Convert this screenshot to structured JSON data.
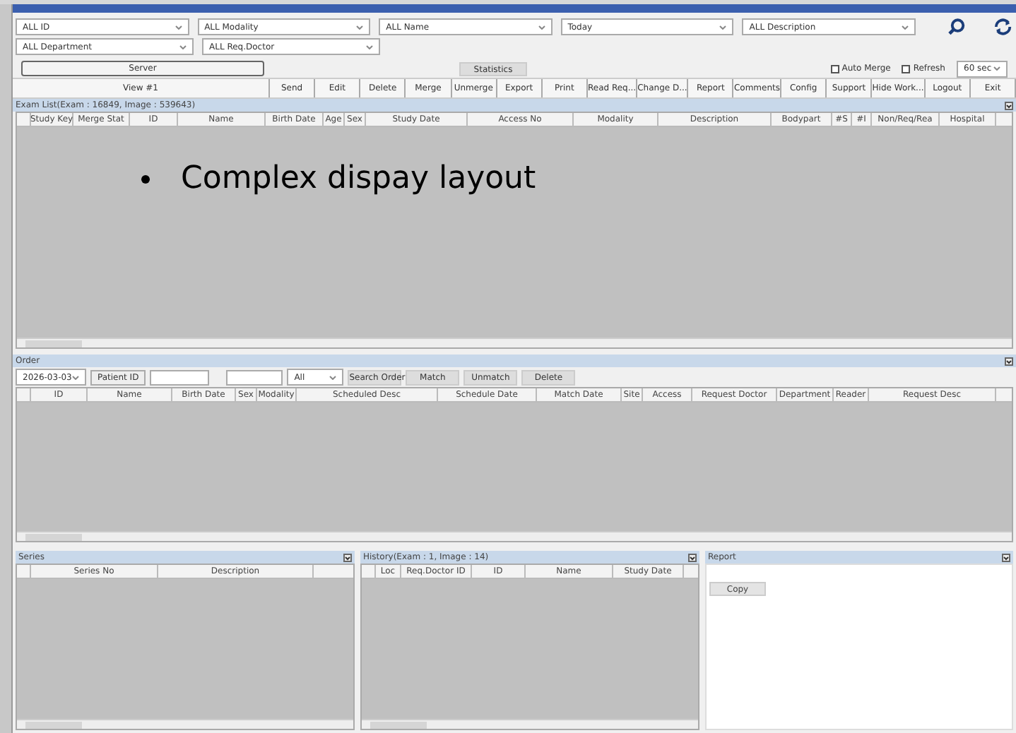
{
  "filters_row1": [
    {
      "value": "ALL ID"
    },
    {
      "value": "ALL Modality"
    },
    {
      "value": "ALL Name"
    },
    {
      "value": "Today"
    },
    {
      "value": "ALL Description"
    }
  ],
  "filters_row2": [
    {
      "value": "ALL Department"
    },
    {
      "value": "ALL Req.Doctor"
    }
  ],
  "server_button": "Server",
  "statistics_button": "Statistics",
  "options": [
    {
      "label": "Auto Merge",
      "checked": false
    },
    {
      "label": "Refresh",
      "checked": false
    }
  ],
  "interval": "60 sec",
  "view_selector": "View #1",
  "toolbar": [
    "Send",
    "Edit",
    "Delete",
    "Merge",
    "Unmerge",
    "Export",
    "Print",
    "Read Req...",
    "Change D...",
    "Report",
    "Comments",
    "Config",
    "Support",
    "Hide Work...",
    "Logout",
    "Exit"
  ],
  "exam_list": {
    "title": "Exam List(Exam : 16849, Image : 539643)",
    "columns": [
      "Study Key",
      "Merge Stat",
      "ID",
      "Name",
      "Birth Date",
      "Age",
      "Sex",
      "Study Date",
      "Access No",
      "Modality",
      "Description",
      "Bodypart",
      "#S",
      "#I",
      "Non/Req/Rea",
      "Hospital"
    ]
  },
  "overlay_bullet": "Complex dispay layout",
  "order": {
    "title": "Order",
    "date": "2026-03-03",
    "patient_id_button": "Patient ID",
    "filter_value": "All",
    "buttons": [
      "Search Order",
      "Match",
      "Unmatch",
      "Delete"
    ],
    "columns": [
      "ID",
      "Name",
      "Birth Date",
      "Sex",
      "Modality",
      "Scheduled Desc",
      "Schedule Date",
      "Match Date",
      "Site",
      "Access",
      "Request Doctor",
      "Department",
      "Reader",
      "Request Desc"
    ]
  },
  "series": {
    "title": "Series",
    "columns": [
      "Series No",
      "Description"
    ]
  },
  "history": {
    "title": "History(Exam : 1, Image : 14)",
    "columns": [
      "Loc",
      "Req.Doctor ID",
      "ID",
      "Name",
      "Study Date"
    ]
  },
  "report": {
    "title": "Report",
    "button": "Copy"
  }
}
